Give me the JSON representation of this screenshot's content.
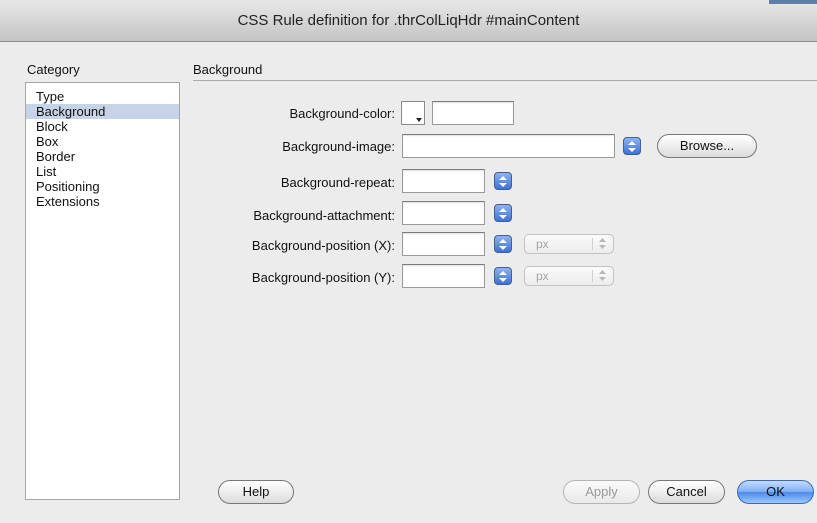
{
  "window": {
    "title": "CSS Rule definition for .thrColLiqHdr #mainContent"
  },
  "category": {
    "label": "Category",
    "items": [
      "Type",
      "Background",
      "Block",
      "Box",
      "Border",
      "List",
      "Positioning",
      "Extensions"
    ],
    "selected": "Background"
  },
  "panel": {
    "title": "Background",
    "background_color": {
      "label": "Background-color:",
      "value": ""
    },
    "background_image": {
      "label": "Background-image:",
      "value": "",
      "browse_label": "Browse..."
    },
    "background_repeat": {
      "label": "Background-repeat:",
      "value": ""
    },
    "background_attachment": {
      "label": "Background-attachment:",
      "value": ""
    },
    "background_position_x": {
      "label": "Background-position (X):",
      "value": "",
      "unit": "px"
    },
    "background_position_y": {
      "label": "Background-position (Y):",
      "value": "",
      "unit": "px"
    }
  },
  "buttons": {
    "help": "Help",
    "apply": "Apply",
    "cancel": "Cancel",
    "ok": "OK"
  },
  "colors": {
    "selection": "#c7d3e6",
    "stepper": "#3d71d6",
    "default_button": "#4b8ae8"
  }
}
